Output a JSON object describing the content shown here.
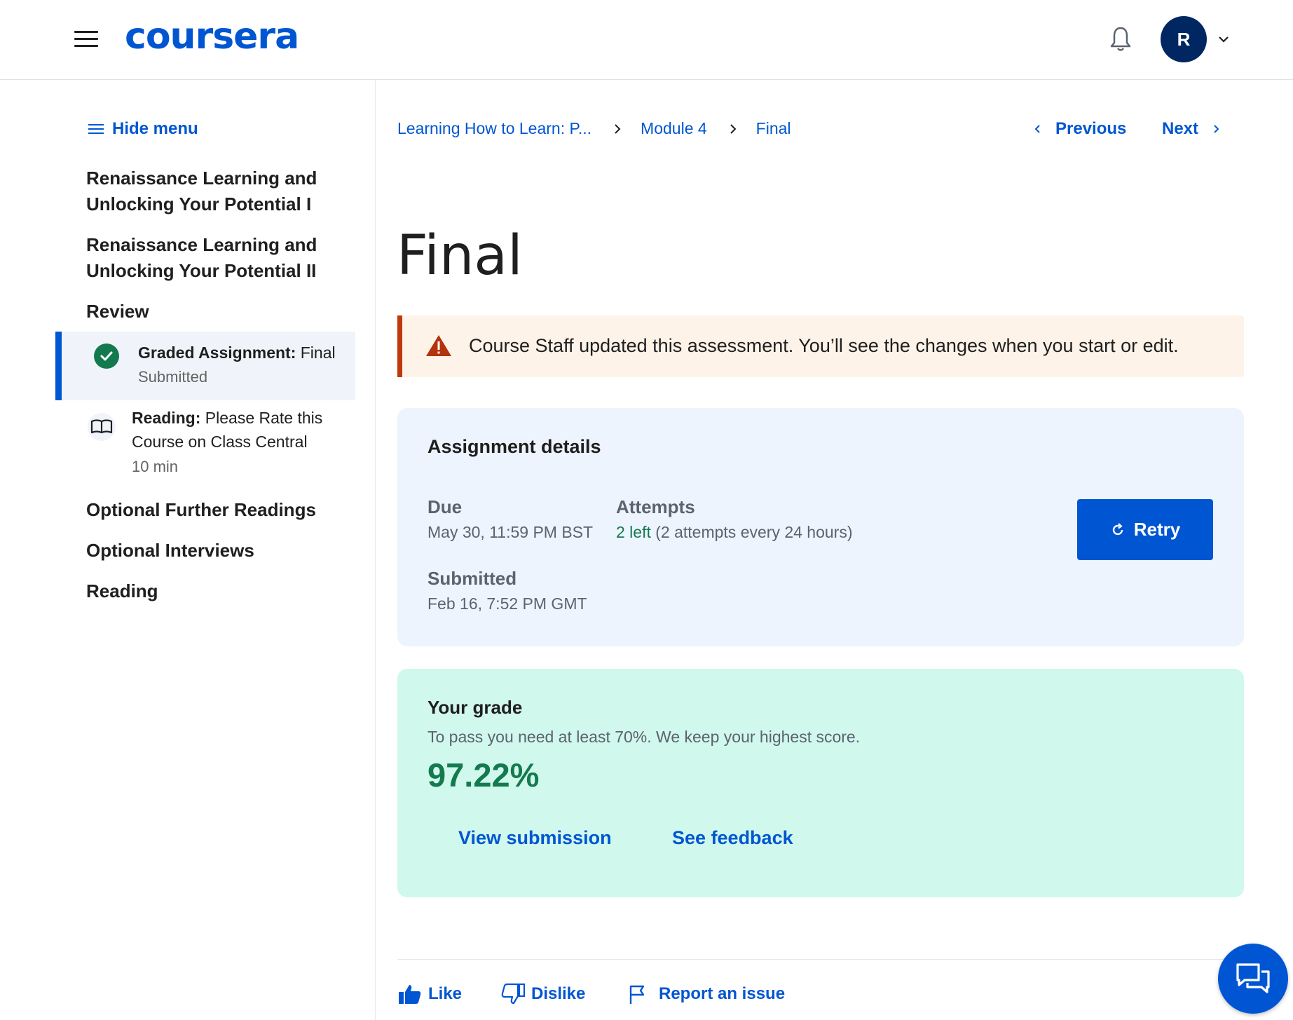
{
  "header": {
    "logo_text": "coursera",
    "avatar_initial": "R"
  },
  "sidebar": {
    "hide_menu_label": "Hide menu",
    "sections": [
      {
        "label": "Renaissance Learning and Unlocking Your Potential I"
      },
      {
        "label": "Renaissance Learning and Unlocking Your Potential II"
      },
      {
        "label": "Review"
      }
    ],
    "items": [
      {
        "type_label": "Graded Assignment:",
        "title": "Final",
        "status": "Submitted",
        "active": true
      },
      {
        "type_label": "Reading:",
        "title": "Please Rate this Course on Class Central",
        "meta": "10 min"
      }
    ],
    "sections_after": [
      {
        "label": "Optional Further Readings"
      },
      {
        "label": "Optional Interviews"
      },
      {
        "label": "Reading"
      }
    ]
  },
  "breadcrumbs": [
    "Learning How to Learn: P...",
    "Module 4",
    "Final"
  ],
  "nav": {
    "previous_label": "Previous",
    "next_label": "Next"
  },
  "page": {
    "title": "Final"
  },
  "alert": {
    "text": "Course Staff updated this assessment. You’ll see the changes when you start or edit.",
    "color": "#c0390b"
  },
  "assignment_details": {
    "heading": "Assignment details",
    "due_label": "Due",
    "due_value": "May 30, 11:59 PM BST",
    "attempts_label": "Attempts",
    "attempts_left": "2 left",
    "attempts_rule": "(2 attempts every 24 hours)",
    "submitted_label": "Submitted",
    "submitted_value": "Feb 16, 7:52 PM GMT",
    "retry_label": "Retry"
  },
  "grade": {
    "heading": "Your grade",
    "subtitle": "To pass you need at least 70%. We keep your highest score.",
    "score": "97.22%",
    "view_submission_label": "View submission",
    "see_feedback_label": "See feedback"
  },
  "feedback": {
    "like_label": "Like",
    "dislike_label": "Dislike",
    "report_label": "Report an issue"
  },
  "colors": {
    "brand": "#0056d2",
    "success": "#137a4f",
    "details_bg": "#eef4fd",
    "grade_bg": "#d1f8ec",
    "alert_bg": "#fdf3e8"
  }
}
